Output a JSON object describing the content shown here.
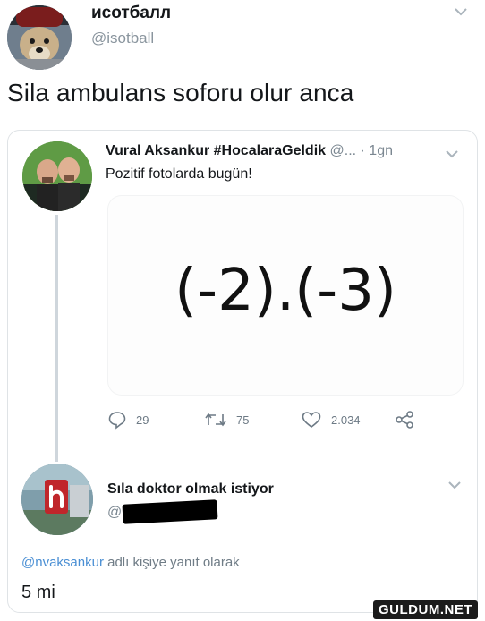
{
  "outer_tweet": {
    "display_name": "исотбалл",
    "handle": "@isotball",
    "text": "Sila ambulans soforu olur anca"
  },
  "quoted_tweet": {
    "display_name": "Vural Aksankur #HocalaraGeldik",
    "handle": "@...",
    "time": "· 1gn",
    "text": "Pozitif fotolarda bugün!",
    "image_text": "(-2).(-3)",
    "actions": {
      "replies": "29",
      "retweets": "75",
      "likes": "2.034"
    }
  },
  "reply_tweet": {
    "display_name": "Sıla doktor olmak istiyor",
    "handle": "@",
    "reply_to_mention": "@nvaksankur",
    "reply_to_suffix": " adlı kişiye yanıt olarak",
    "text": "5 mi"
  },
  "watermark": "GULDUM.NET",
  "colors": {
    "link": "#4a8fd4",
    "muted": "#7b8791",
    "divider": "#cfd6dc"
  },
  "icons": [
    "chevron-down-icon",
    "reply-icon",
    "retweet-icon",
    "like-icon",
    "share-icon"
  ]
}
